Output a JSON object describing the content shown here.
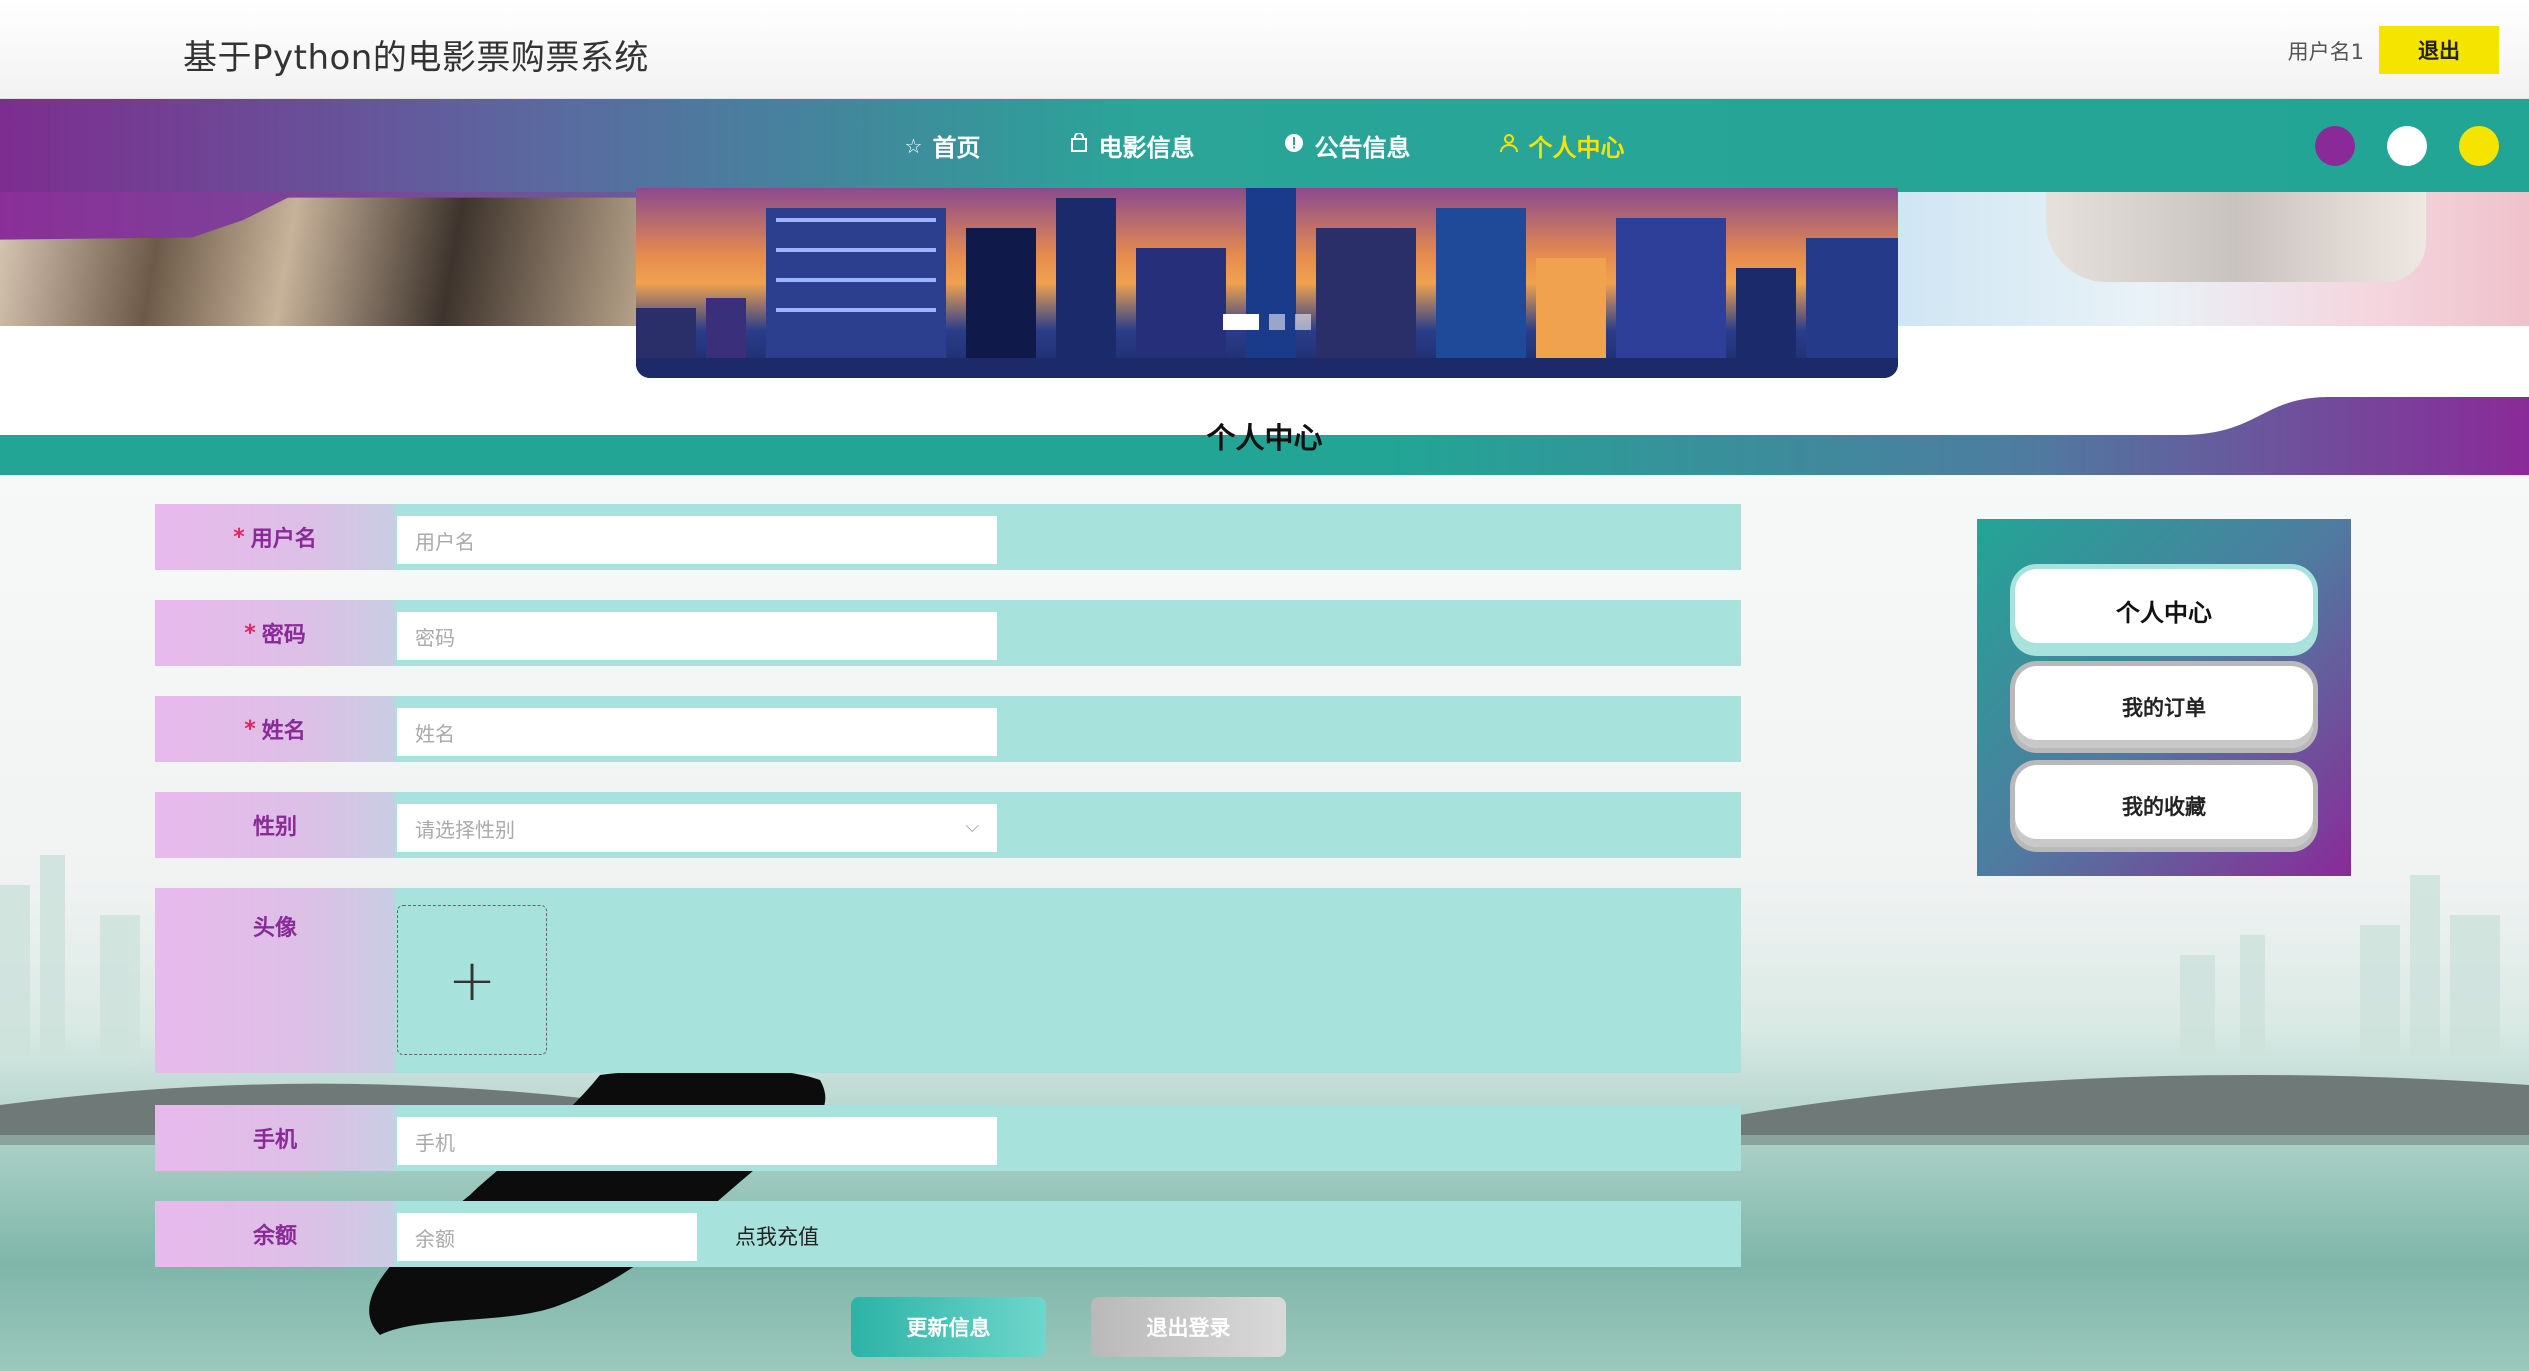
{
  "header": {
    "title": "基于Python的电影票购票系统",
    "username": "用户名1",
    "logout_label": "退出"
  },
  "nav": {
    "items": [
      {
        "label": "首页",
        "icon": "star-icon"
      },
      {
        "label": "电影信息",
        "icon": "bag-icon"
      },
      {
        "label": "公告信息",
        "icon": "alert-icon"
      },
      {
        "label": "个人中心",
        "icon": "user-icon"
      }
    ],
    "active_index": 3,
    "theme_colors": [
      "#8a2a98",
      "#ffffff",
      "#f5e400"
    ]
  },
  "carousel": {
    "slide_count": 3,
    "active_index": 0
  },
  "section_title": "个人中心",
  "form": {
    "username": {
      "label": "用户名",
      "placeholder": "用户名",
      "required": true
    },
    "password": {
      "label": "密码",
      "placeholder": "密码",
      "required": true
    },
    "name": {
      "label": "姓名",
      "placeholder": "姓名",
      "required": true
    },
    "gender": {
      "label": "性别",
      "placeholder": "请选择性别"
    },
    "avatar": {
      "label": "头像",
      "upload_symbol": "+"
    },
    "phone": {
      "label": "手机",
      "placeholder": "手机"
    },
    "balance": {
      "label": "余额",
      "placeholder": "余额",
      "recharge_label": "点我充值"
    },
    "required_mark": "*"
  },
  "actions": {
    "update_label": "更新信息",
    "logout_label": "退出登录"
  },
  "side_menu": {
    "items": [
      "个人中心",
      "我的订单",
      "我的收藏"
    ],
    "active_index": 0
  },
  "colors": {
    "accent_teal": "#22a595",
    "accent_purple": "#8a2a98",
    "accent_yellow": "#f5e400",
    "form_row_bg": "#a7e2dd"
  }
}
